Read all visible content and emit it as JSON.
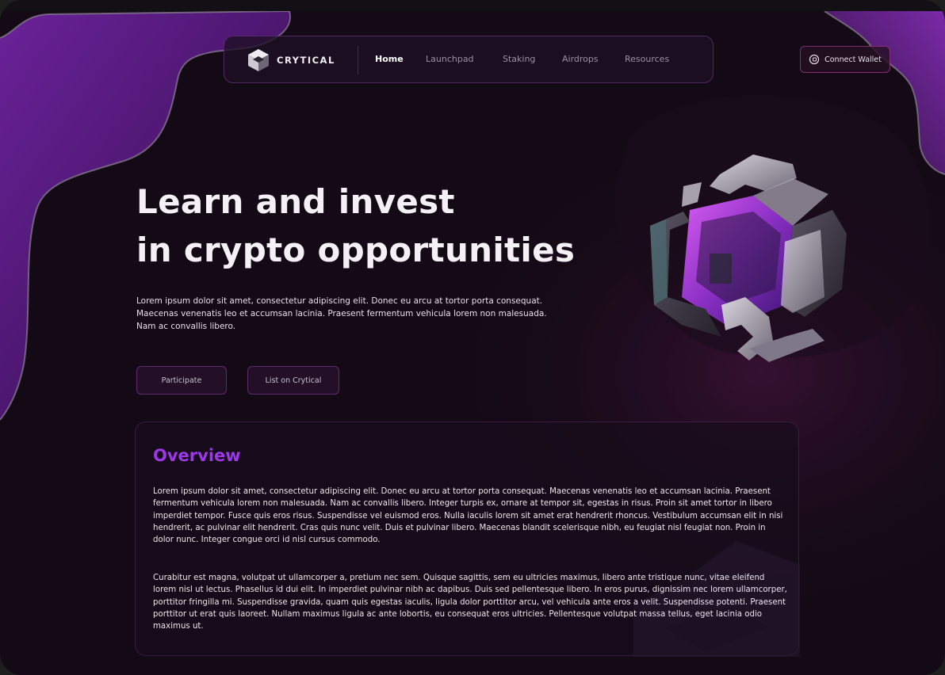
{
  "brand": {
    "name": "CRYTICAL",
    "logo_icon": "cube-logo-icon"
  },
  "nav": {
    "items": [
      {
        "label": "Home",
        "active": true
      },
      {
        "label": "Launchpad",
        "active": false
      },
      {
        "label": "Staking",
        "active": false
      },
      {
        "label": "Airdrops",
        "active": false
      },
      {
        "label": "Resources",
        "active": false
      }
    ]
  },
  "connect": {
    "label": "Connect Wallet",
    "icon": "wallet-icon"
  },
  "hero": {
    "title_line1": "Learn and invest",
    "title_line2": "in crypto opportunities",
    "description": "Lorem ipsum dolor sit amet, consectetur adipiscing elit. Donec eu arcu at tortor porta consequat. Maecenas venenatis leo et accumsan lacinia. Praesent fermentum vehicula lorem non malesuada. Nam ac convallis libero.",
    "primary_button": "Participate",
    "secondary_button": "List on Crytical",
    "illustration": "3d-crypto-cube"
  },
  "overview": {
    "title": "Overview",
    "paragraph1": "Lorem ipsum dolor sit amet, consectetur adipiscing elit. Donec eu arcu at tortor porta consequat. Maecenas venenatis leo et accumsan lacinia. Praesent fermentum vehicula lorem non malesuada. Nam ac convallis libero. Integer turpis ex, ornare at tempor sit, egestas in risus. Proin sit amet tortor in libero imperdiet tempor. Fusce quis eros risus. Suspendisse vel euismod eros. Nulla iaculis lorem sit amet erat hendrerit rhoncus. Vestibulum accumsan elit in nisi hendrerit, ac pulvinar elit hendrerit. Cras quis nunc velit. Duis et pulvinar libero. Maecenas blandit scelerisque nibh, eu feugiat nisl feugiat non. Proin in dolor nunc. Integer congue orci id nisl cursus commodo.",
    "paragraph2": "Curabitur est magna, volutpat ut ullamcorper a, pretium nec sem. Quisque sagittis, sem eu ultricies maximus, libero ante tristique nunc, vitae eleifend lorem nisl ut lectus. Phasellus id dui elit. In imperdiet pulvinar nibh ac dapibus. Duis sed pellentesque libero. In eros purus, dignissim nec lorem ullamcorper, porttitor fringilla mi. Suspendisse gravida, quam quis egestas iaculis, ligula dolor porttitor arcu, vel vehicula ante eros a velit. Suspendisse potenti. Praesent porttitor ut erat quis laoreet. Nullam maximus ligula ac ante lobortis, eu consequat eros ultricies. Pellentesque volutpat massa tellus, eget lacinia odio maximus ut."
  },
  "colors": {
    "background": "#140a16",
    "accent_purple": "#9c38e6",
    "blob_purple": "#5b1d86",
    "button_border": "#6e3282"
  }
}
